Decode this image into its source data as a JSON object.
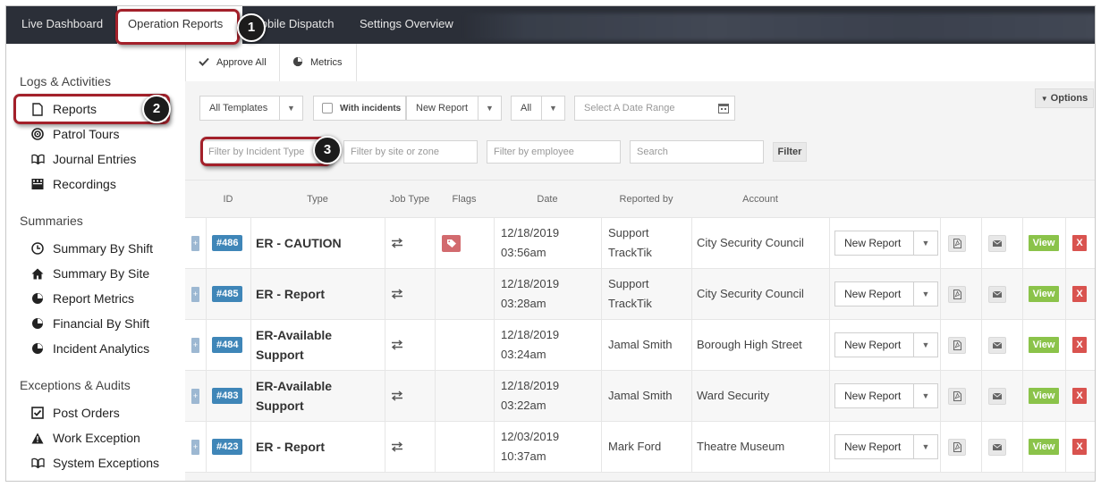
{
  "nav": {
    "tabs": [
      {
        "label": "Live Dashboard"
      },
      {
        "label": "Operation Reports"
      },
      {
        "label": "Mobile Dispatch"
      },
      {
        "label": "Settings Overview"
      }
    ]
  },
  "callouts": [
    "1",
    "2",
    "3"
  ],
  "sidebar": {
    "sections": [
      {
        "title": "Logs & Activities",
        "items": [
          {
            "label": "Reports",
            "icon": "document-icon"
          },
          {
            "label": "Patrol Tours",
            "icon": "target-icon"
          },
          {
            "label": "Journal Entries",
            "icon": "book-icon"
          },
          {
            "label": "Recordings",
            "icon": "film-icon"
          }
        ]
      },
      {
        "title": "Summaries",
        "items": [
          {
            "label": "Summary By Shift",
            "icon": "clock-icon"
          },
          {
            "label": "Summary By Site",
            "icon": "home-icon"
          },
          {
            "label": "Report Metrics",
            "icon": "pie-chart-icon"
          },
          {
            "label": "Financial By Shift",
            "icon": "pie-chart-icon"
          },
          {
            "label": "Incident Analytics",
            "icon": "pie-chart-icon"
          }
        ]
      },
      {
        "title": "Exceptions & Audits",
        "items": [
          {
            "label": "Post Orders",
            "icon": "checkbox-icon"
          },
          {
            "label": "Work Exception",
            "icon": "warning-icon"
          },
          {
            "label": "System Exceptions",
            "icon": "book-icon"
          }
        ]
      }
    ]
  },
  "toolbar": {
    "approve_all": "Approve All",
    "metrics": "Metrics"
  },
  "filters": {
    "templates": "All Templates",
    "with_incidents": "With incidents",
    "new_report": "New Report",
    "all": "All",
    "date_range_placeholder": "Select A Date Range",
    "options": "Options",
    "incident_type_placeholder": "Filter by Incident Type",
    "site_placeholder": "Filter by site or zone",
    "employee_placeholder": "Filter by employee",
    "search_placeholder": "Search",
    "filter_button": "Filter"
  },
  "table": {
    "headers": {
      "id": "ID",
      "type": "Type",
      "job_type": "Job Type",
      "flags": "Flags",
      "date": "Date",
      "reported_by": "Reported by",
      "account": "Account"
    },
    "rows": [
      {
        "id": "#486",
        "type": "ER - CAUTION",
        "date": "12/18/2019",
        "time": "03:56am",
        "reported_by": "Support TrackTik",
        "account": "City Security Council",
        "flag": true,
        "action": "New Report",
        "view": "View",
        "delete": "X"
      },
      {
        "id": "#485",
        "type": "ER - Report",
        "date": "12/18/2019",
        "time": "03:28am",
        "reported_by": "Support TrackTik",
        "account": "City Security Council",
        "flag": false,
        "action": "New Report",
        "view": "View",
        "delete": "X"
      },
      {
        "id": "#484",
        "type": "ER-Available Support",
        "date": "12/18/2019",
        "time": "03:24am",
        "reported_by": "Jamal Smith",
        "account": "Borough High Street",
        "flag": false,
        "action": "New Report",
        "view": "View",
        "delete": "X"
      },
      {
        "id": "#483",
        "type": "ER-Available Support",
        "date": "12/18/2019",
        "time": "03:22am",
        "reported_by": "Jamal Smith",
        "account": "Ward Security",
        "flag": false,
        "action": "New Report",
        "view": "View",
        "delete": "X"
      },
      {
        "id": "#423",
        "type": "ER - Report",
        "date": "12/03/2019",
        "time": "10:37am",
        "reported_by": "Mark Ford",
        "account": "Theatre Museum",
        "flag": false,
        "action": "New Report",
        "view": "View",
        "delete": "X"
      }
    ]
  },
  "colors": {
    "nav_bg": "#2b2f38",
    "callout": "#a3202a",
    "id_badge": "#3f86b8",
    "view": "#8bc34a",
    "delete": "#d9534f",
    "flag": "#d26a6e"
  }
}
